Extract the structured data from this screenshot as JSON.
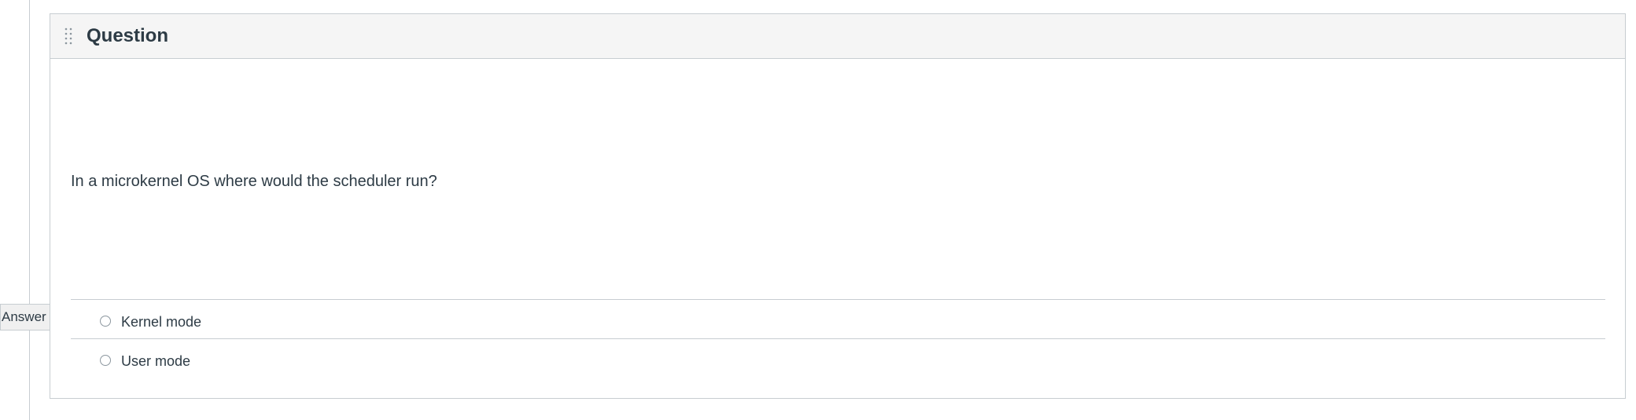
{
  "question": {
    "title": "Question",
    "text": "In a microkernel OS where would the scheduler run?",
    "answer_flag_label": "Answer",
    "answers": [
      {
        "label": "Kernel mode",
        "selected": false
      },
      {
        "label": "User mode",
        "selected": false
      }
    ]
  },
  "colors": {
    "text": "#2d3b45",
    "border": "#c7cdd1",
    "header_bg": "#f5f5f5"
  },
  "icons": {
    "drag_handle": "drag-handle-icon",
    "radio": "radio-icon"
  }
}
